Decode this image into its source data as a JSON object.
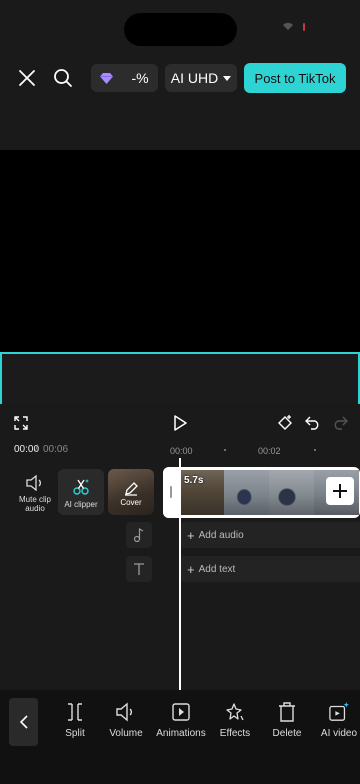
{
  "top_bar": {
    "credit_label": "-%",
    "quality_label": "AI UHD",
    "post_label": "Post to TikTok"
  },
  "time": {
    "current": "00:00",
    "separator": "/",
    "total": "00:06"
  },
  "ruler": {
    "labels": [
      "00:00",
      "00:02"
    ]
  },
  "timeline_tools": {
    "mute_label": "Mute clip audio",
    "ai_clipper_label": "AI clipper",
    "cover_label": "Cover"
  },
  "clip": {
    "duration": "5.7s"
  },
  "tracks": {
    "add_audio": "Add audio",
    "add_text": "Add text"
  },
  "toolbar": {
    "items": [
      {
        "label": "Split",
        "icon": "split-icon"
      },
      {
        "label": "Volume",
        "icon": "volume-icon"
      },
      {
        "label": "Animations",
        "icon": "animations-icon"
      },
      {
        "label": "Effects",
        "icon": "effects-icon"
      },
      {
        "label": "Delete",
        "icon": "delete-icon"
      },
      {
        "label": "AI video",
        "icon": "ai-video-icon"
      }
    ]
  },
  "colors": {
    "accent": "#2ed4d4",
    "background": "#1a1a1a"
  }
}
